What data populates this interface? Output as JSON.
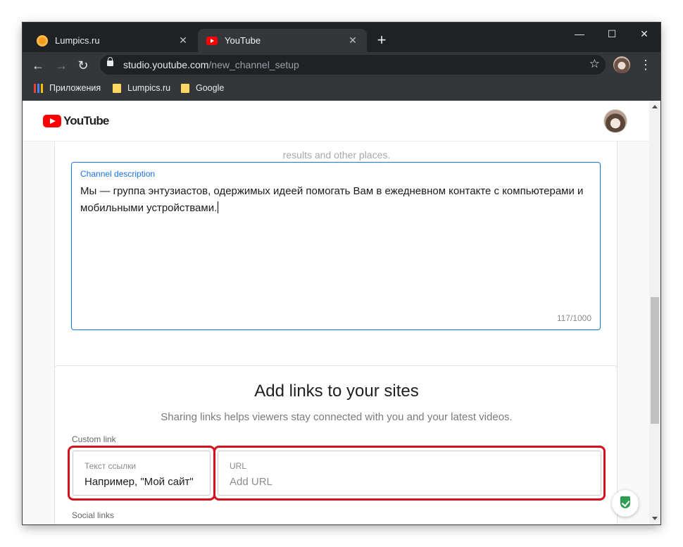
{
  "browser": {
    "tabs": [
      {
        "title": "Lumpics.ru",
        "active": false,
        "favicon": "orange-circle-favicon"
      },
      {
        "title": "YouTube",
        "active": true,
        "favicon": "youtube-favicon"
      }
    ],
    "tab_close_glyph": "✕",
    "new_tab_glyph": "+",
    "window_controls": {
      "minimize": "—",
      "maximize": "☐",
      "close": "✕"
    },
    "nav": {
      "back": "←",
      "forward": "→",
      "reload": "↻"
    },
    "url_host": "studio.youtube.com",
    "url_path": "/new_channel_setup",
    "star_glyph": "☆",
    "menu_glyph": "⋮",
    "bookmarks": [
      {
        "label": "Приложения",
        "icon": "apps-grid-icon"
      },
      {
        "label": "Lumpics.ru",
        "icon": "folder-icon"
      },
      {
        "label": "Google",
        "icon": "folder-icon"
      }
    ]
  },
  "page": {
    "logo_text": "YouTube",
    "faded_text": "results and other places.",
    "description": {
      "label": "Channel description",
      "value": "Мы — группа энтузиастов, одержимых идеей помогать Вам в ежедневном контакте с компьютерами и мобильными устройствами.",
      "counter": "117/1000"
    },
    "links_section": {
      "title": "Add links to your sites",
      "subtitle": "Sharing links helps viewers stay connected with you and your latest videos.",
      "custom_link_label": "Custom link",
      "link_text_field": {
        "label": "Текст ссылки",
        "value": "Например, \"Мой сайт\""
      },
      "url_field": {
        "label": "URL",
        "placeholder": "Add URL"
      },
      "social_links_label": "Social links"
    }
  },
  "colors": {
    "highlight": "#d6111b",
    "focus_blue": "#1a73e8",
    "youtube_red": "#ff0000"
  }
}
